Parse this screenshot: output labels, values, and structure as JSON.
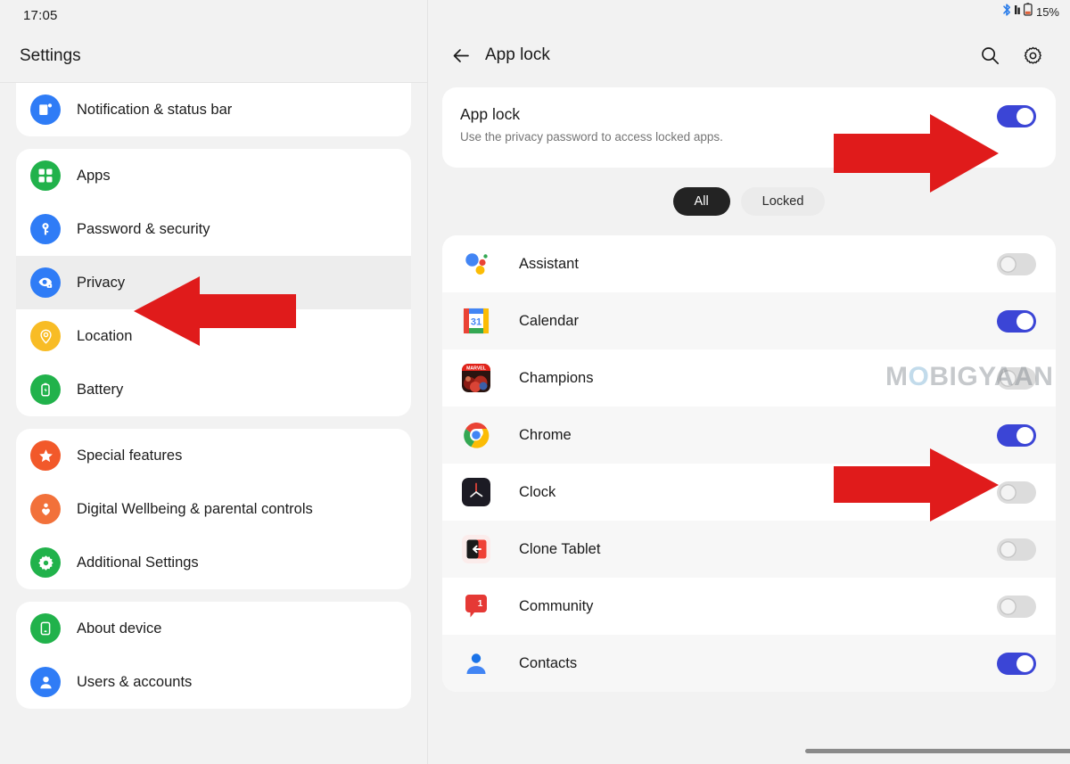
{
  "left": {
    "status": {
      "clock": "17:05"
    },
    "header": {
      "title": "Settings"
    },
    "groups": [
      {
        "items": [
          {
            "label": "Notification & status bar",
            "icon": "notification-bar-icon",
            "color": "#2f7cf6",
            "selected": false
          }
        ]
      },
      {
        "items": [
          {
            "label": "Apps",
            "icon": "apps-grid-icon",
            "color": "#21b24b",
            "selected": false
          },
          {
            "label": "Password & security",
            "icon": "key-icon",
            "color": "#2f7cf6",
            "selected": false
          },
          {
            "label": "Privacy",
            "icon": "privacy-eye-lock-icon",
            "color": "#2f7cf6",
            "selected": true
          },
          {
            "label": "Location",
            "icon": "location-pin-icon",
            "color": "#f8bc25",
            "selected": false
          },
          {
            "label": "Battery",
            "icon": "battery-icon",
            "color": "#21b24b",
            "selected": false
          }
        ]
      },
      {
        "items": [
          {
            "label": "Special features",
            "icon": "star-icon",
            "color": "#f2592a",
            "selected": false
          },
          {
            "label": "Digital Wellbeing & parental controls",
            "icon": "wellbeing-person-icon",
            "color": "#f2713a",
            "selected": false
          },
          {
            "label": "Additional Settings",
            "icon": "gear-icon",
            "color": "#21b24b",
            "selected": false
          }
        ]
      },
      {
        "items": [
          {
            "label": "About device",
            "icon": "device-icon",
            "color": "#21b24b",
            "selected": false
          },
          {
            "label": "Users & accounts",
            "icon": "user-icon",
            "color": "#2f7cf6",
            "selected": false
          }
        ]
      }
    ]
  },
  "right": {
    "status": {
      "battery_percent": "15%",
      "bluetooth": "bluetooth-icon",
      "signal": "signal-icon",
      "battery": "battery-outline-icon"
    },
    "appbar": {
      "back": "back-arrow-icon",
      "title": "App lock",
      "search": "search-icon",
      "settings": "gear-icon"
    },
    "applock": {
      "title": "App lock",
      "subtitle": "Use the privacy password to access locked apps.",
      "enabled": true
    },
    "filters": [
      {
        "label": "All",
        "active": true
      },
      {
        "label": "Locked",
        "active": false
      }
    ],
    "apps": [
      {
        "name": "Assistant",
        "icon": "google-assistant-icon",
        "locked": false
      },
      {
        "name": "Calendar",
        "icon": "google-calendar-icon",
        "locked": true
      },
      {
        "name": "Champions",
        "icon": "marvel-champions-icon",
        "locked": false
      },
      {
        "name": "Chrome",
        "icon": "chrome-icon",
        "locked": true
      },
      {
        "name": "Clock",
        "icon": "clock-icon",
        "locked": false
      },
      {
        "name": "Clone Tablet",
        "icon": "clone-tablet-icon",
        "locked": false
      },
      {
        "name": "Community",
        "icon": "community-icon",
        "locked": false
      },
      {
        "name": "Contacts",
        "icon": "contacts-icon",
        "locked": true
      }
    ]
  },
  "annotations": {
    "color": "#e01b1b",
    "arrows": [
      {
        "name": "arrow-pointing-privacy"
      },
      {
        "name": "arrow-pointing-applock-toggle"
      },
      {
        "name": "arrow-pointing-chrome-toggle"
      }
    ]
  },
  "watermark": {
    "pre": "M",
    "o": "O",
    "post": "BIGYAAN"
  },
  "colors": {
    "toggle_on": "#3b45d6",
    "toggle_off": "#dcdcdc",
    "accent_dark": "#232323"
  }
}
